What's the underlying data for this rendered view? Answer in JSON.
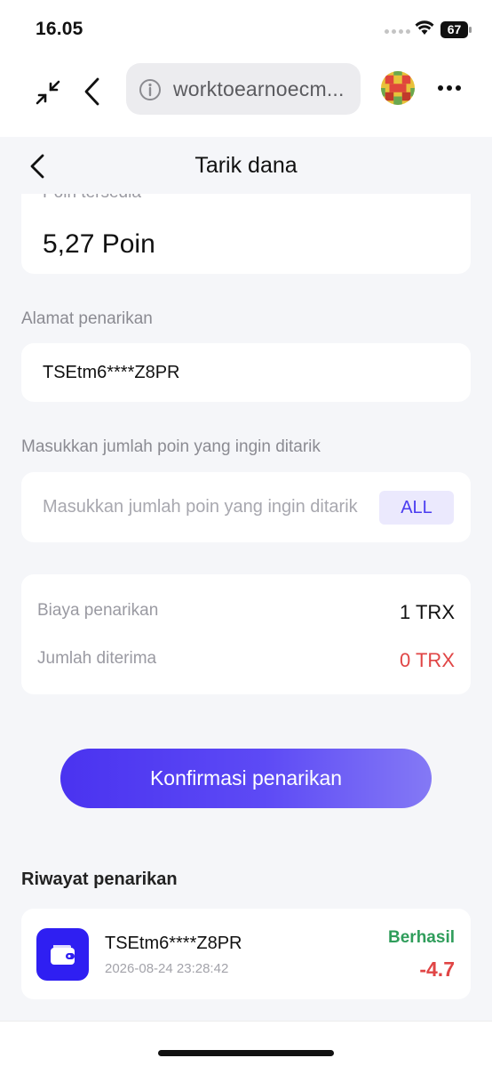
{
  "status_bar": {
    "time": "16.05",
    "battery": "67"
  },
  "browser": {
    "url": "worktoearnoecm..."
  },
  "page": {
    "title": "Tarik dana",
    "points_label": "Poin tersedia",
    "points_value": "5,27 Poin",
    "address_label": "Alamat penarikan",
    "address_value": "TSEtm6****Z8PR",
    "amount_label": "Masukkan jumlah poin yang ingin ditarik",
    "amount_placeholder": "Masukkan jumlah poin yang ingin ditarik",
    "all_label": "ALL",
    "fee_label": "Biaya penarikan",
    "fee_value": "1 TRX",
    "received_label": "Jumlah diterima",
    "received_value": "0 TRX",
    "confirm_label": "Konfirmasi penarikan",
    "history_title": "Riwayat penarikan",
    "history": [
      {
        "address": "TSEtm6****Z8PR",
        "date": "2026-08-24 23:28:42",
        "status": "Berhasil",
        "amount": "-4.7"
      }
    ]
  },
  "colors": {
    "accent": "#4a33f0",
    "success": "#2f9d5b",
    "danger": "#e04545",
    "background": "#f5f6f9"
  },
  "icons": [
    "wifi-icon",
    "battery-icon",
    "collapse-icon",
    "back-icon",
    "info-icon",
    "more-icon",
    "wallet-icon"
  ]
}
